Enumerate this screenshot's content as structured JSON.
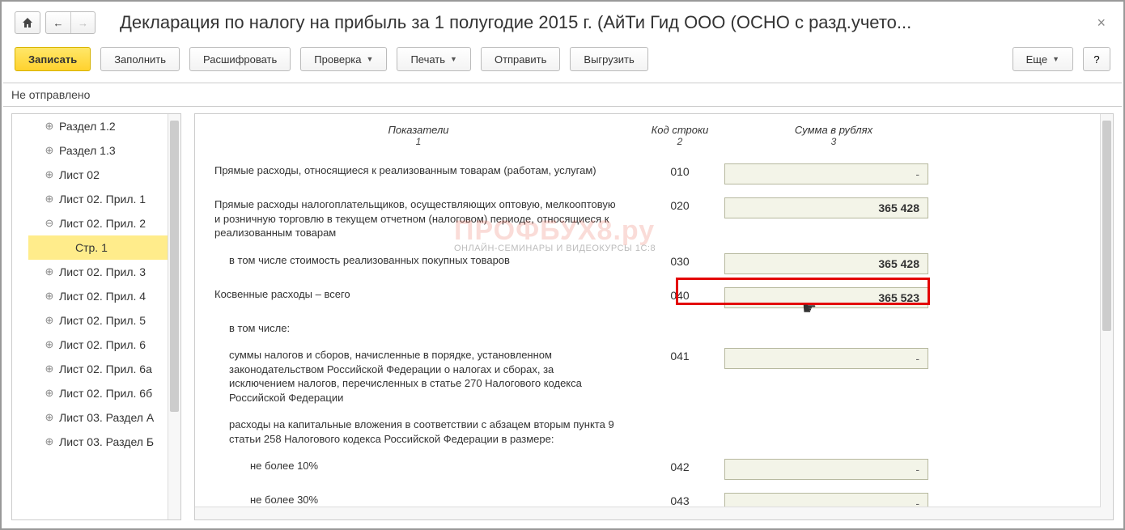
{
  "title": "Декларация по налогу на прибыль за 1 полугодие 2015 г. (АйТи Гид ООО (ОСНО с разд.учето...",
  "toolbar": {
    "save": "Записать",
    "fill": "Заполнить",
    "decode": "Расшифровать",
    "check": "Проверка",
    "print": "Печать",
    "send": "Отправить",
    "export": "Выгрузить",
    "more": "Еще",
    "help": "?"
  },
  "status": "Не отправлено",
  "sidebar": [
    {
      "label": "Раздел 1.2",
      "exp": "⊕"
    },
    {
      "label": "Раздел 1.3",
      "exp": "⊕"
    },
    {
      "label": "Лист 02",
      "exp": "⊕"
    },
    {
      "label": "Лист 02. Прил. 1",
      "exp": "⊕"
    },
    {
      "label": "Лист 02. Прил. 2",
      "exp": "⊖",
      "open": true
    },
    {
      "label": "Стр. 1",
      "sub": true,
      "active": true
    },
    {
      "label": "Лист 02. Прил. 3",
      "exp": "⊕"
    },
    {
      "label": "Лист 02. Прил. 4",
      "exp": "⊕"
    },
    {
      "label": "Лист 02. Прил. 5",
      "exp": "⊕"
    },
    {
      "label": "Лист 02. Прил. 6",
      "exp": "⊕"
    },
    {
      "label": "Лист 02. Прил. 6а",
      "exp": "⊕"
    },
    {
      "label": "Лист 02. Прил. 6б",
      "exp": "⊕"
    },
    {
      "label": "Лист 03. Раздел А",
      "exp": "⊕"
    },
    {
      "label": "Лист 03. Раздел Б",
      "exp": "⊕"
    }
  ],
  "table_header": {
    "col1": "Показатели",
    "col1_sub": "1",
    "col2": "Код строки",
    "col2_sub": "2",
    "col3": "Сумма в рублях",
    "col3_sub": "3"
  },
  "rows": [
    {
      "text": "Прямые расходы, относящиеся к реализованным товарам (работам, услугам)",
      "code": "010",
      "sum": "-",
      "indent": 0
    },
    {
      "text": "Прямые расходы налогоплательщиков, осуществляющих оптовую, мелкооптовую и розничную торговлю в текущем отчетном (налоговом) периоде, относящиеся к реализованным товарам",
      "code": "020",
      "sum": "365 428",
      "indent": 0
    },
    {
      "text": "в том числе стоимость реализованных покупных товаров",
      "code": "030",
      "sum": "365 428",
      "indent": 1
    },
    {
      "text": "Косвенные расходы – всего",
      "code": "040",
      "sum": "365 523",
      "indent": 0,
      "highlight": true
    },
    {
      "text": "в том числе:",
      "code": "",
      "sum": null,
      "indent": 1
    },
    {
      "text": "суммы налогов и сборов, начисленные в порядке, установленном законодательством Российской Федерации о налогах и сборах, за исключением налогов, перечисленных в статье 270 Налогового кодекса Российской Федерации",
      "code": "041",
      "sum": "-",
      "indent": 1
    },
    {
      "text": "расходы на капитальные вложения в соответствии с абзацем вторым пункта 9 статьи 258 Налогового кодекса Российской Федерации в размере:",
      "code": "",
      "sum": null,
      "indent": 1
    },
    {
      "text": "не более 10%",
      "code": "042",
      "sum": "-",
      "indent": 2
    },
    {
      "text": "не более 30%",
      "code": "043",
      "sum": "-",
      "indent": 2
    }
  ],
  "watermark": {
    "main": "ПРОФБУХ8.ру",
    "sub": "ОНЛАЙН-СЕМИНАРЫ И ВИДЕОКУРСЫ 1С:8"
  }
}
